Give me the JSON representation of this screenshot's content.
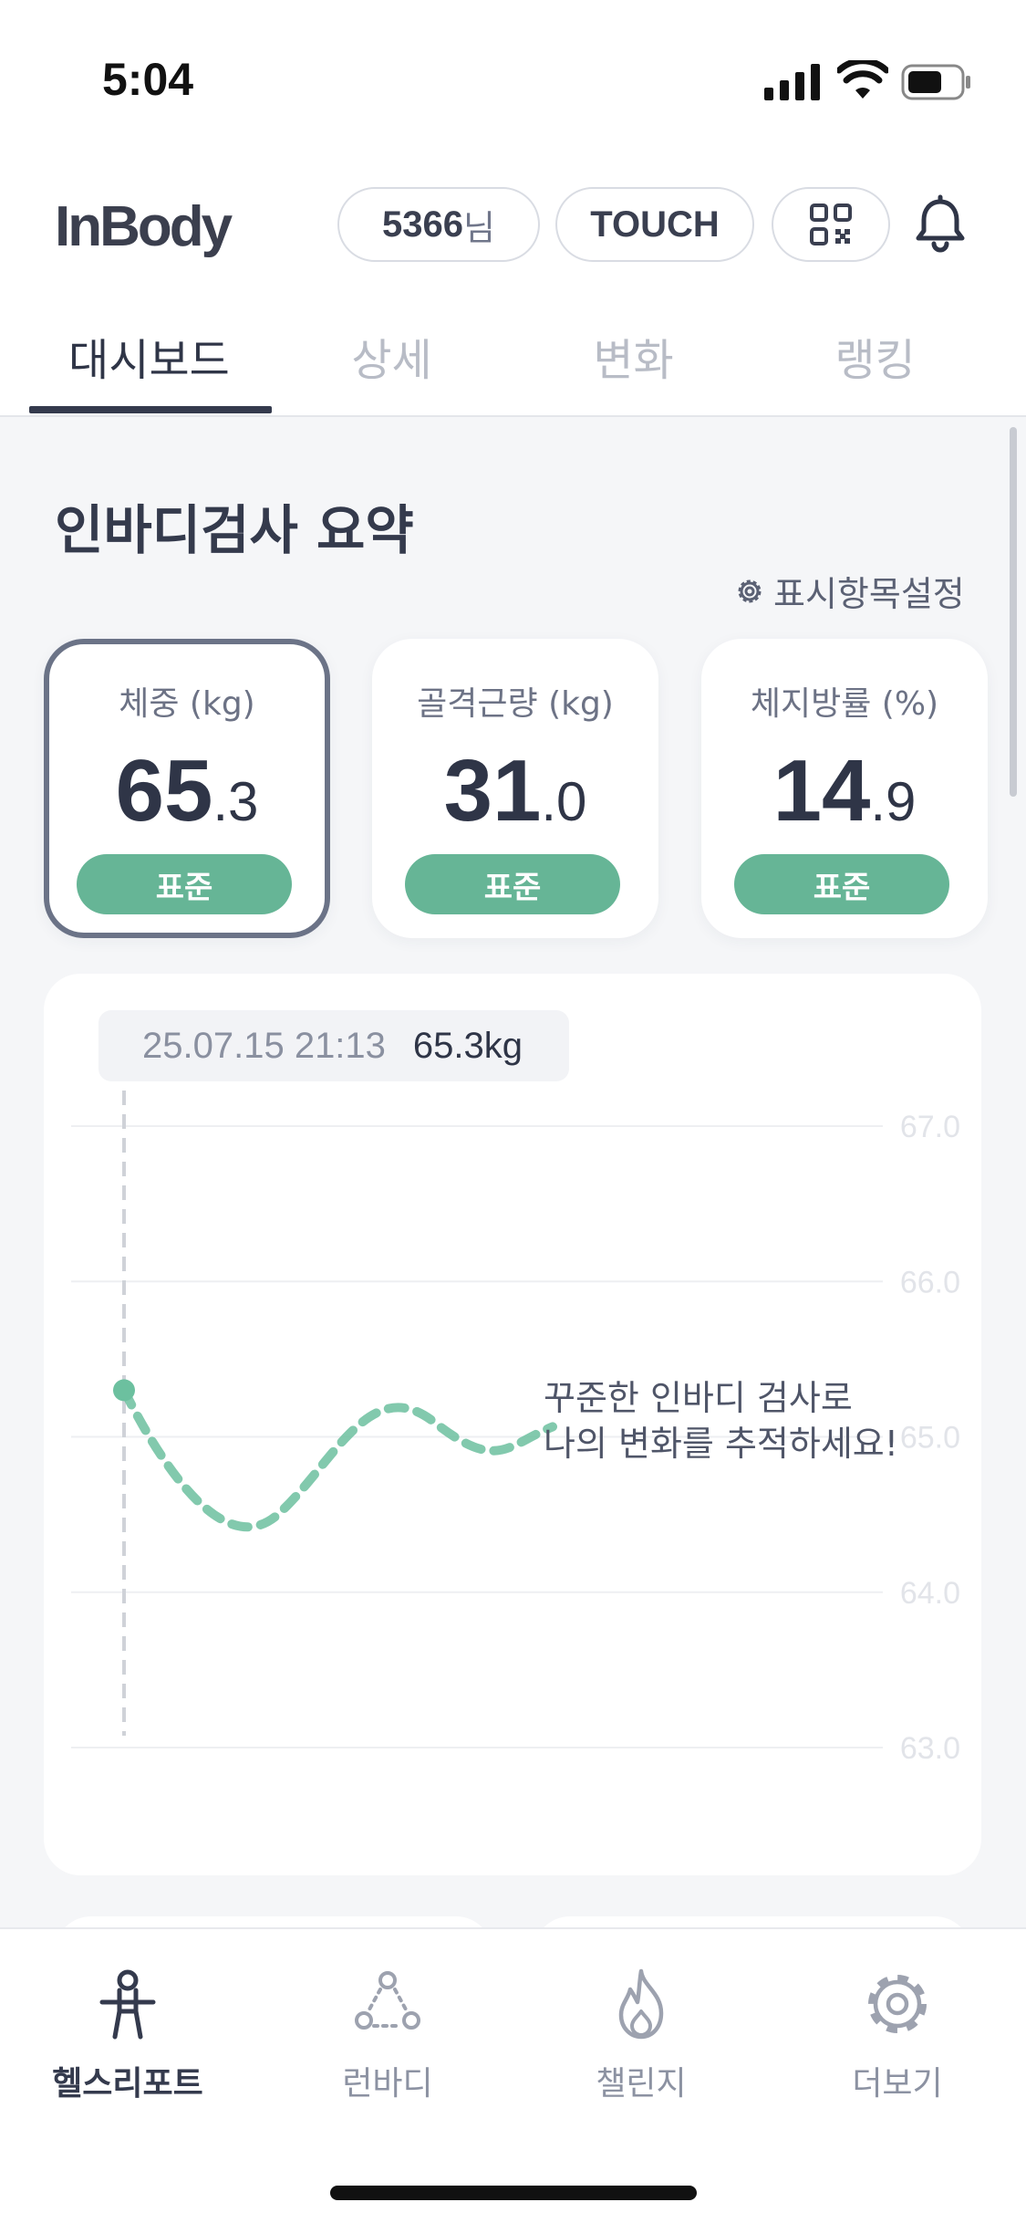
{
  "status_bar": {
    "time": "5:04"
  },
  "header": {
    "logo": "InBody",
    "user_id": "5366",
    "user_suffix": "님",
    "touch_label": "TOUCH"
  },
  "tabs": [
    {
      "label": "대시보드",
      "active": true
    },
    {
      "label": "상세",
      "active": false
    },
    {
      "label": "변화",
      "active": false
    },
    {
      "label": "랭킹",
      "active": false
    }
  ],
  "summary": {
    "title": "인바디검사 요약",
    "settings_label": "표시항목설정",
    "metrics": [
      {
        "label": "체중 (kg)",
        "value_int": "65",
        "value_dec": ".3",
        "status": "표준",
        "selected": true
      },
      {
        "label": "골격근량 (kg)",
        "value_int": "31",
        "value_dec": ".0",
        "status": "표준",
        "selected": false
      },
      {
        "label": "체지방률 (%)",
        "value_int": "14",
        "value_dec": ".9",
        "status": "표준",
        "selected": false
      }
    ]
  },
  "chart_data": {
    "type": "line",
    "tooltip_date": "25.07.15 21:13",
    "tooltip_value": "65.3kg",
    "y_ticks": [
      "67.0",
      "66.0",
      "65.0",
      "64.0",
      "63.0"
    ],
    "ylim": [
      63.0,
      67.0
    ],
    "series": [
      {
        "values": [
          65.3
        ]
      }
    ],
    "message_line1": "꾸준한 인바디 검사로",
    "message_line2": "나의 변화를 추적하세요!",
    "colors": {
      "line": "#6cc09f",
      "grid": "#eeeff2",
      "tick": "#e2e4e9"
    }
  },
  "bottom_nav": [
    {
      "label": "헬스리포트",
      "icon": "health-report-icon",
      "active": true
    },
    {
      "label": "런바디",
      "icon": "runbody-icon",
      "active": false
    },
    {
      "label": "챌린지",
      "icon": "flame-icon",
      "active": false
    },
    {
      "label": "더보기",
      "icon": "gear-icon",
      "active": false
    }
  ]
}
